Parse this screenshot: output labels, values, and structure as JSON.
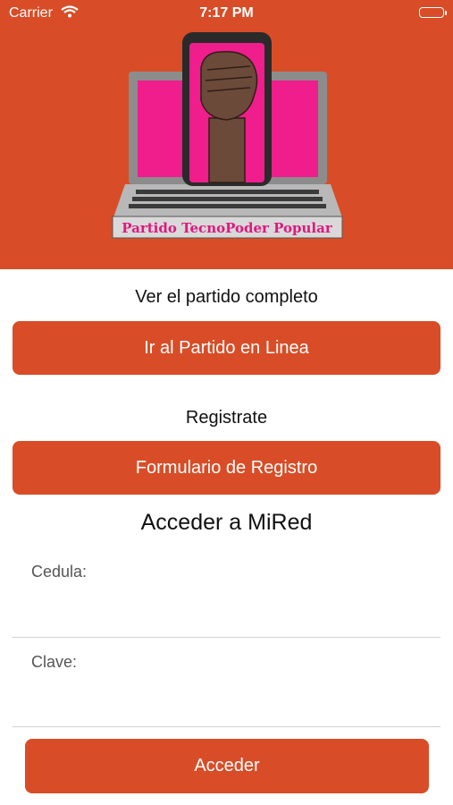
{
  "status_bar": {
    "carrier": "Carrier",
    "time": "7:17 PM"
  },
  "logo": {
    "banner_text": "Partido TecnoPoder Popular"
  },
  "live": {
    "label": "Ver el partido completo",
    "button": "Ir al Partido en Linea"
  },
  "register": {
    "label": "Registrate",
    "button": "Formulario de Registro"
  },
  "login": {
    "title": "Acceder a MiRed",
    "cedula_label": "Cedula:",
    "cedula_value": "",
    "clave_label": "Clave:",
    "clave_value": "",
    "submit": "Acceder"
  },
  "colors": {
    "accent": "#d84d27",
    "screen_pink": "#f01d8c"
  }
}
